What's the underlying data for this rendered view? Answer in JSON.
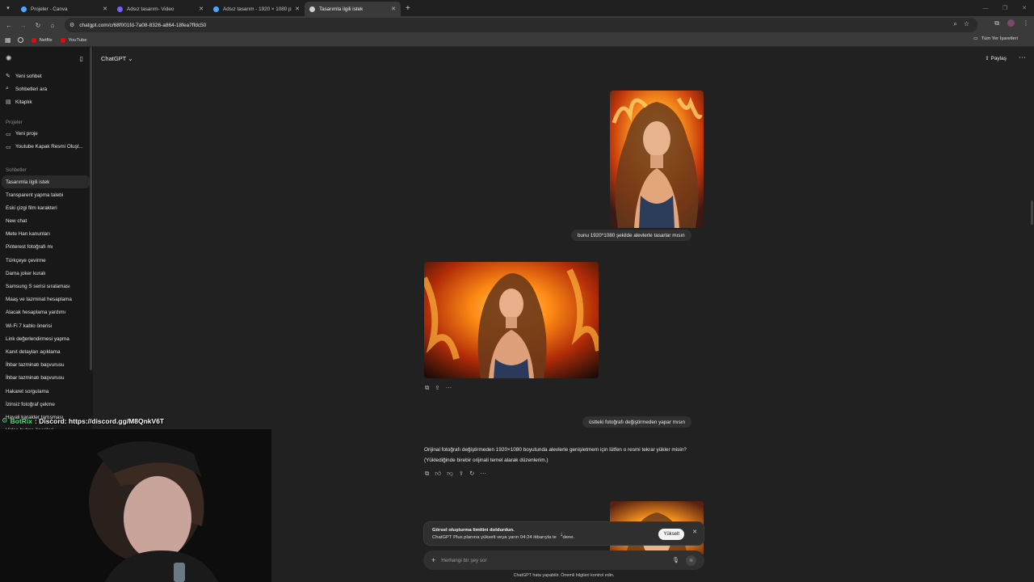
{
  "browser": {
    "tabs": [
      {
        "title": "Projeler - Canva",
        "color": "#4aa8ff",
        "active": false
      },
      {
        "title": "Adsız tasarım- Video",
        "color": "#7b5cff",
        "active": false
      },
      {
        "title": "Adsız tasarım - 1920 × 1080 px",
        "color": "#4aa8ff",
        "active": false
      },
      {
        "title": "Tasarımla ilgili istek",
        "color": "#cfcfcf",
        "active": true
      }
    ],
    "url": "chatgpt.com/c/68f001fd-7a08-8326-a864-18fea7ffdc50",
    "bookmarks": [
      {
        "label": "Netflix",
        "color": "#e50914"
      },
      {
        "label": "YouTube",
        "color": "#ff0000"
      }
    ],
    "all_bookmarks": "Tüm Yer İşaretleri"
  },
  "sidebar": {
    "top_items": [
      {
        "label": "Yeni sohbet",
        "icon": "edit-icon"
      },
      {
        "label": "Sohbetleri ara",
        "icon": "search-icon"
      },
      {
        "label": "Kitaplık",
        "icon": "library-icon"
      }
    ],
    "projects_heading": "Projeler",
    "projects": [
      {
        "label": "Yeni proje",
        "icon": "folder-plus-icon"
      },
      {
        "label": "Youtube Kapak Resmi Oluşt...",
        "icon": "folder-icon"
      }
    ],
    "chats_heading": "Sohbetler",
    "chats": [
      "Tasarımla ilgili istek",
      "Transparent yapma talebi",
      "Eski çizgi film karakteri",
      "New chat",
      "Mete Han kanunları",
      "Pinterest fotoğrafı mı",
      "Türkçeye çevirme",
      "Dama joker kuralı",
      "Samsung S serisi sıralaması",
      "Maaş ve tazminat hesaplama",
      "Alacak hesaplama yardımı",
      "Wi-Fi 7 kablo önerisi",
      "Link değerlendirmesi yapma",
      "Kanıt detayları açıklama",
      "İhbar tazminatı başvurusu",
      "İhbar tazminatı başvurusu",
      "Hakaret sorgulama",
      "İzinsiz fotoğraf çekme",
      "Hayali karakter tartışması",
      "Video bulma önerileri"
    ]
  },
  "header": {
    "model": "ChatGPT",
    "share": "Paylaş"
  },
  "conversation": {
    "user_msg_1": "bunu 1920*1080 şekilde alevlerle tasarlar mısın",
    "user_msg_2": "üstteki fotoğrafı değiştirmeden yapar mısın",
    "assistant_reply": "Orijinal fotoğrafı değiştirmeden 1920×1080 boyutunda alevlerle genişletmem için lütfen o resmi tekrar yükler misin? (Yüklediğinde birebir orijinali temel alarak düzenlerim.)"
  },
  "limit_banner": {
    "title": "Görsel oluşturma limitini doldurdun.",
    "body_pre": "ChatGPT Plus planına yükselt veya yarın 04:24 itibarıyla te",
    "body_post": "dene.",
    "button": "Yükselt"
  },
  "composer": {
    "placeholder": "Herhangi bir şey sor"
  },
  "disclaimer": "ChatGPT hata yapabilir. Önemli bilgileri kontrol edin.",
  "stream_overlay": {
    "bot": "BotRix",
    "text": ": Discord: https://discord.gg/M8QnkV6T"
  }
}
